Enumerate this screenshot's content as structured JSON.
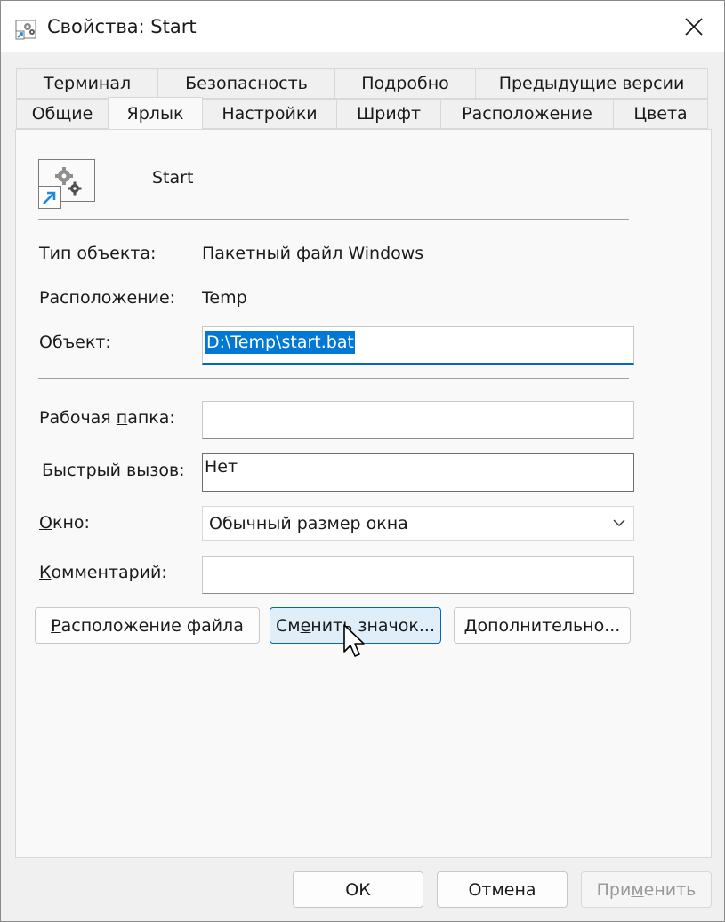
{
  "window": {
    "title": "Свойства: Start",
    "title_icon": "bat-file-gear-icon",
    "close_icon": "close-icon"
  },
  "tabs": {
    "row1": [
      "Терминал",
      "Безопасность",
      "Подробно",
      "Предыдущие версии"
    ],
    "row2": [
      "Общие",
      "Ярлык",
      "Настройки",
      "Шрифт",
      "Расположение",
      "Цвета"
    ],
    "active": "Ярлык"
  },
  "shortcut": {
    "name": "Start",
    "icon": "gears-shortcut-icon"
  },
  "fields": {
    "type_label": "Тип объекта:",
    "type_value": "Пакетный файл Windows",
    "location_label": "Расположение:",
    "location_value": "Temp",
    "target_label_a": "Об",
    "target_label_u": "ъ",
    "target_label_b": "ект:",
    "target_value": "D:\\Temp\\start.bat",
    "workdir_label_a": "Рабочая ",
    "workdir_label_u": "п",
    "workdir_label_b": "апка:",
    "workdir_value": "",
    "hotkey_label_a": "Б",
    "hotkey_label_u": "ы",
    "hotkey_label_b": "стрый вызов:",
    "hotkey_value": "Нет",
    "window_label_u": "О",
    "window_label_b": "кно:",
    "window_value": "Обычный размер окна",
    "comment_label_u": "К",
    "comment_label_b": "омментарий:",
    "comment_value": ""
  },
  "buttons": {
    "open_location_u": "Р",
    "open_location_b": "асположение файла",
    "change_icon_a": "См",
    "change_icon_u": "е",
    "change_icon_b": "нить значок...",
    "advanced_u": "Д",
    "advanced_b": "ополнительно..."
  },
  "footer": {
    "ok": "ОК",
    "cancel": "Отмена",
    "apply_a": "При",
    "apply_u": "м",
    "apply_b": "енить"
  },
  "colors": {
    "accent": "#0078d4",
    "hover_button": "#e0eef9",
    "disabled_text": "#9a9a9a"
  }
}
